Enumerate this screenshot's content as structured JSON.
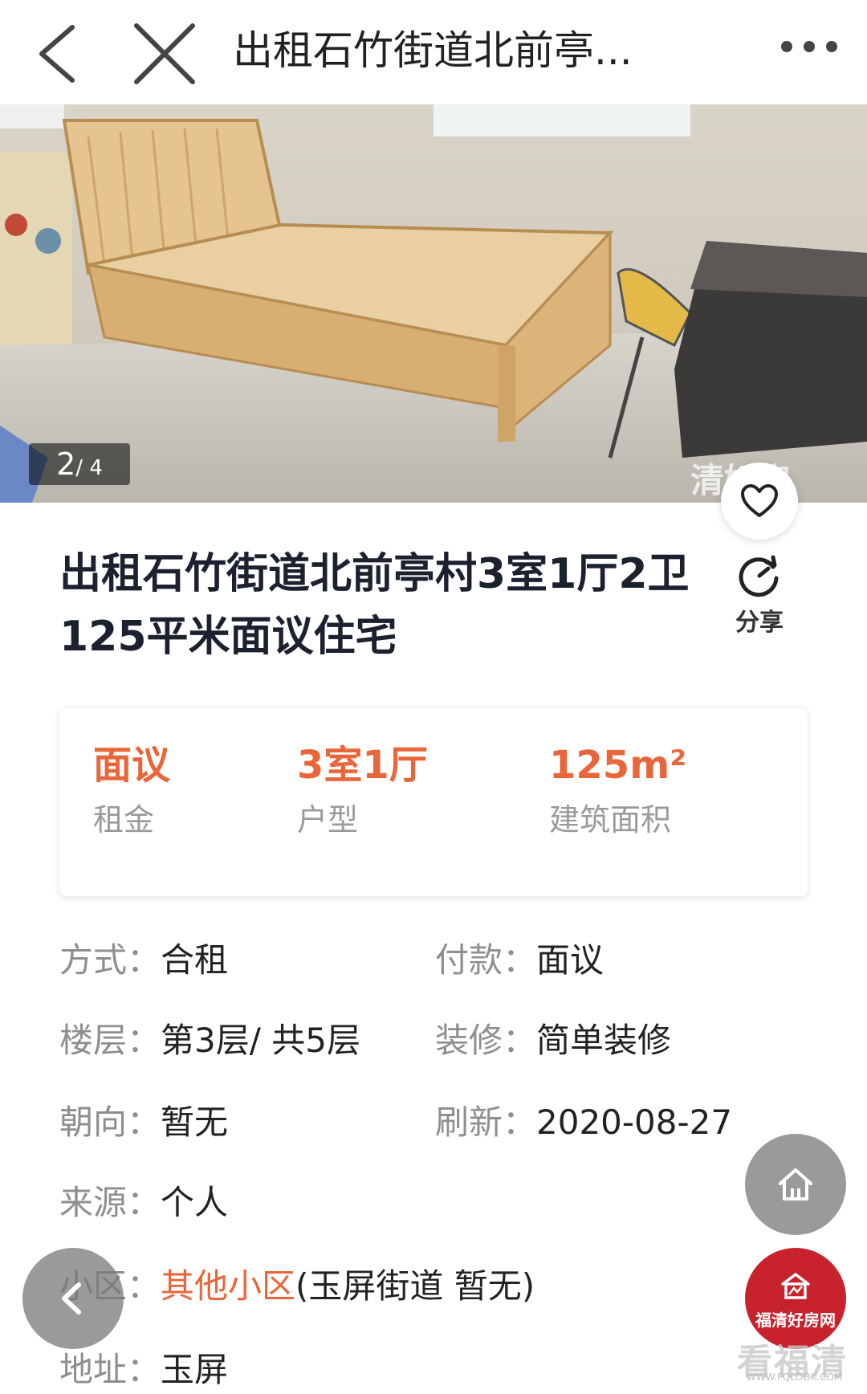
{
  "topbar": {
    "title": "出租石竹街道北前亭...",
    "back_icon": "chevron-left-icon",
    "close_icon": "close-icon",
    "more_icon": "more-horizontal-icon"
  },
  "photo": {
    "counter_current": "2",
    "counter_total": "/ 4",
    "watermark": "清好房"
  },
  "listing": {
    "title": "出租石竹街道北前亭村3室1厅2卫125平米面议住宅",
    "share_label": "分享"
  },
  "summary": [
    {
      "value": "面议",
      "label": "租金"
    },
    {
      "value": "3室1厅",
      "label": "户型"
    },
    {
      "value": "125m²",
      "label": "建筑面积"
    }
  ],
  "details": {
    "mode_label": "方式：",
    "mode_value": "合租",
    "payment_label": "付款：",
    "payment_value": "面议",
    "floor_label": "楼层：",
    "floor_value": "第3层/ 共5层",
    "decoration_label": "装修：",
    "decoration_value": "简单装修",
    "orientation_label": "朝向：",
    "orientation_value": "暂无",
    "refresh_label": "刷新：",
    "refresh_value": "2020-08-27",
    "source_label": "来源：",
    "source_value": "个人",
    "community_label": "小区：",
    "community_link": "其他小区",
    "community_extra": "(玉屏街道 暂无)",
    "address_label": "地址：",
    "address_value": "玉屏"
  },
  "floating": {
    "brand_text": "福清好房网",
    "site_watermark": "看福清",
    "site_url": "WWW.FQLOOK.COM"
  },
  "colors": {
    "accent": "#e8663a",
    "title": "#1c2130",
    "brand_red": "#c8232c"
  }
}
